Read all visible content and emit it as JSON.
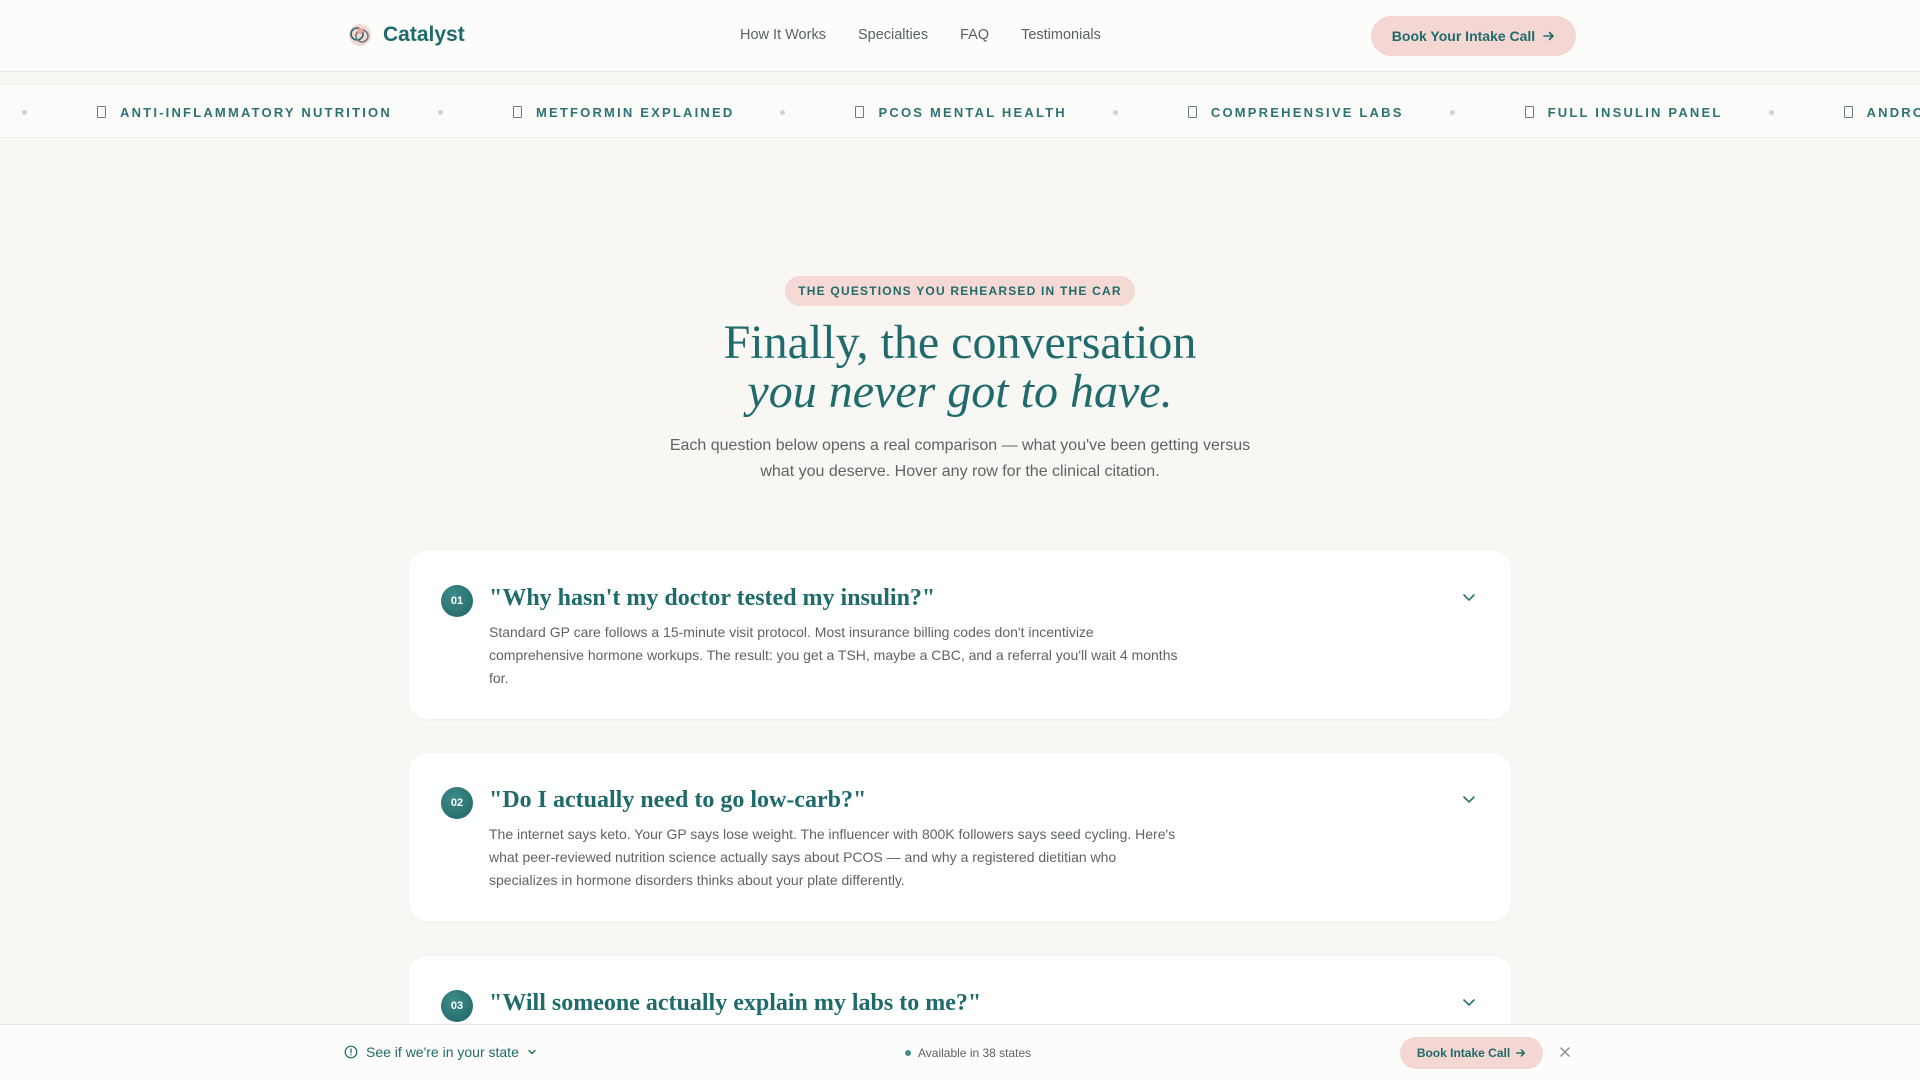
{
  "header": {
    "brand": "Catalyst",
    "logo_icon": "catalyst-logo-icon",
    "nav": [
      {
        "label": "How It Works"
      },
      {
        "label": "Specialties"
      },
      {
        "label": "FAQ"
      },
      {
        "label": "Testimonials"
      }
    ],
    "cta_label": "Book Your Intake Call",
    "cta_icon": "arrow-right-icon"
  },
  "ticker": {
    "items": [
      {
        "label": "ANTI-INFLAMMATORY NUTRITION"
      },
      {
        "label": "METFORMIN EXPLAINED"
      },
      {
        "label": "PCOS MENTAL HEALTH"
      },
      {
        "label": "COMPREHENSIVE LABS"
      },
      {
        "label": "FULL INSULIN PANEL"
      },
      {
        "label": "ANDROGEN MAPPING"
      }
    ],
    "item_icon": "bookmark-icon"
  },
  "hero": {
    "eyebrow": "THE QUESTIONS YOU REHEARSED IN THE CAR",
    "title_line1": "Finally, the conversation",
    "title_line2": "you never got to have.",
    "subtitle": "Each question below opens a real comparison — what you've been getting versus what you deserve. Hover any row for the clinical citation."
  },
  "faqs": [
    {
      "number": "01",
      "question": "\"Why hasn't my doctor tested my insulin?\"",
      "answer": "Standard GP care follows a 15-minute visit protocol. Most insurance billing codes don't incentivize comprehensive hormone workups. The result: you get a TSH, maybe a CBC, and a referral you'll wait 4 months for."
    },
    {
      "number": "02",
      "question": "\"Do I actually need to go low-carb?\"",
      "answer": "The internet says keto. Your GP says lose weight. The influencer with 800K followers says seed cycling. Here's what peer-reviewed nutrition science actually says about PCOS — and why a registered dietitian who specializes in hormone disorders thinks about your plate differently."
    },
    {
      "number": "03",
      "question": "\"Will someone actually explain my labs to me?\"",
      "answer": ""
    }
  ],
  "bottom_bar": {
    "state_check": "See if we're in your state",
    "availability": "Available in 38 states",
    "cta_label": "Book Intake Call"
  },
  "colors": {
    "brand": "#1f6b6b",
    "accent_pink": "#f4d7d2",
    "background": "#f8f7f4"
  }
}
